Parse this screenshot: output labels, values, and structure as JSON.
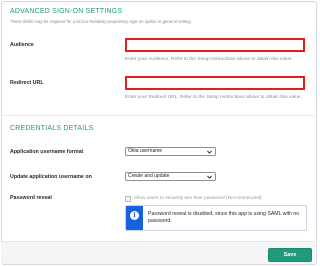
{
  "advanced": {
    "title": "ADVANCED SIGN-ON SETTINGS",
    "note": "These fields may be required for a kCura Relativity proprietary sign-on option or general setting.",
    "audience": {
      "label": "Audience",
      "value": "",
      "help": "Enter your Audience. Refer to the Setup Instructions above to obtain this value."
    },
    "redirect_url": {
      "label": "Redirect URL",
      "value": "",
      "help": "Enter your Redirect URL. Refer to the Setup Instructions above to obtain this value."
    },
    "error_border_color": "#e01e1e"
  },
  "credentials": {
    "title": "CREDENTIALS DETAILS",
    "username_format": {
      "label": "Application username format",
      "selected": "Okta username"
    },
    "update_username": {
      "label": "Update application username on",
      "selected": "Create and update"
    },
    "password_reveal": {
      "label": "Password reveal",
      "checkbox_label": "Allow users to securely see their password (Recommended)",
      "checked": false,
      "info_icon": "info-icon",
      "info_message": "Password reveal is disabled, since this app is using SAML with no password."
    }
  },
  "footer": {
    "save_label": "Save"
  },
  "colors": {
    "accent": "#1f9a7c",
    "info": "#1662dd"
  }
}
